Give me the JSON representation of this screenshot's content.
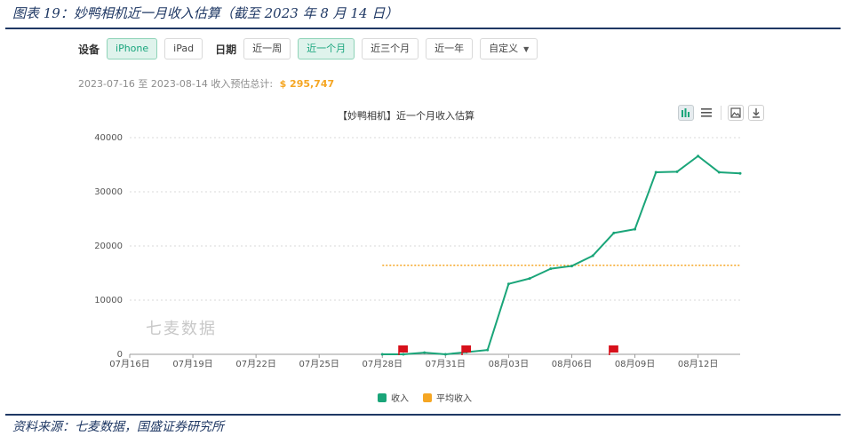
{
  "figure": {
    "title": "图表 19：妙鸭相机近一月收入估算（截至 2023 年 8 月 14 日）",
    "source": "资料来源：七麦数据，国盛证券研究所"
  },
  "toolbar": {
    "device_label": "设备",
    "devices": [
      "iPhone",
      "iPad"
    ],
    "device_selected": "iPhone",
    "date_label": "日期",
    "ranges": [
      "近一周",
      "近一个月",
      "近三个月",
      "近一年",
      "自定义"
    ],
    "range_selected": "近一个月"
  },
  "summary": {
    "text": "2023-07-16 至 2023-08-14 收入预估总计:",
    "amount": "$ 295,747",
    "amount_color": "#f5a623"
  },
  "watermark": "七麦数据",
  "icons": [
    "bar-chart-icon",
    "list-icon",
    "image-download-icon",
    "download-icon"
  ],
  "chart_data": {
    "type": "line",
    "title": "【妙鸭相机】近一个月收入估算",
    "x_tick_labels": [
      "07月16日",
      "07月19日",
      "07月22日",
      "07月25日",
      "07月28日",
      "07月31日",
      "08月03日",
      "08月06日",
      "08月09日",
      "08月12日"
    ],
    "y_ticks": [
      0,
      10000,
      20000,
      30000,
      40000
    ],
    "ylim": [
      0,
      40000
    ],
    "x_start": "07月16日",
    "days": 30,
    "grid": true,
    "legend_position": "bottom",
    "series": [
      {
        "name": "收入",
        "color": "#1aa579",
        "x": [
          "07月28日",
          "07月29日",
          "07月30日",
          "07月31日",
          "08月01日",
          "08月02日",
          "08月03日",
          "08月04日",
          "08月05日",
          "08月06日",
          "08月07日",
          "08月08日",
          "08月09日",
          "08月10日",
          "08月11日",
          "08月12日",
          "08月13日",
          "08月14日"
        ],
        "values": [
          0,
          0,
          300,
          0,
          400,
          800,
          13000,
          14000,
          15800,
          16300,
          18200,
          22400,
          23100,
          33600,
          33700,
          36600,
          33600,
          33400
        ]
      },
      {
        "name": "平均收入",
        "color": "#f5a623",
        "x": [
          "07月28日",
          "08月14日"
        ],
        "values": [
          16430,
          16430
        ]
      }
    ],
    "event_markers": [
      "07月29日",
      "08月01日",
      "08月08日"
    ],
    "marker_color": "#d7101b"
  }
}
